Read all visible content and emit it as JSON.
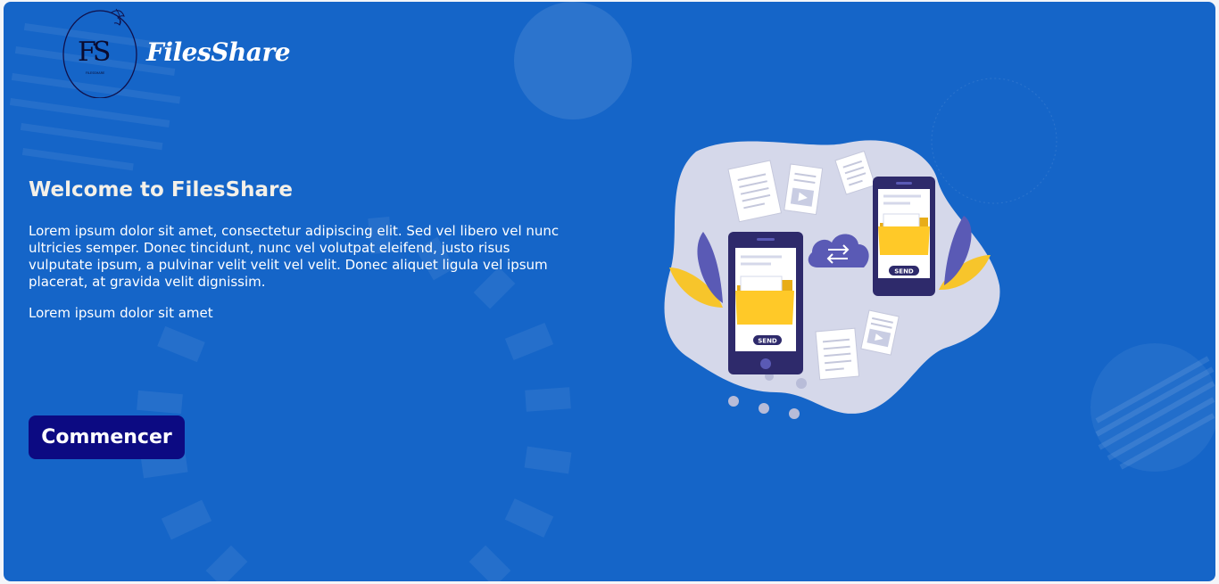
{
  "header": {
    "brand_name": "FilesShare",
    "logo_letters": "FS",
    "logo_subtext": "FILESSHARE"
  },
  "hero": {
    "title": "Welcome to FilesShare",
    "paragraph": "Lorem ipsum dolor sit amet, consectetur adipiscing elit. Sed vel libero vel nunc ultricies semper. Donec tincidunt, nunc vel volutpat eleifend, justo risus vulputate ipsum, a pulvinar velit velit vel velit. Donec aliquet ligula vel ipsum placerat, at gravida velit dignissim.",
    "subtext": "Lorem ipsum dolor sit amet",
    "cta_label": "Commencer"
  },
  "illustration": {
    "send_label_left": "SEND",
    "send_label_right": "SEND"
  },
  "colors": {
    "background": "#1565c8",
    "button": "#0c0a82",
    "folder": "#ffc928",
    "phone": "#2e2a6b",
    "blob": "#d5d8ea"
  }
}
